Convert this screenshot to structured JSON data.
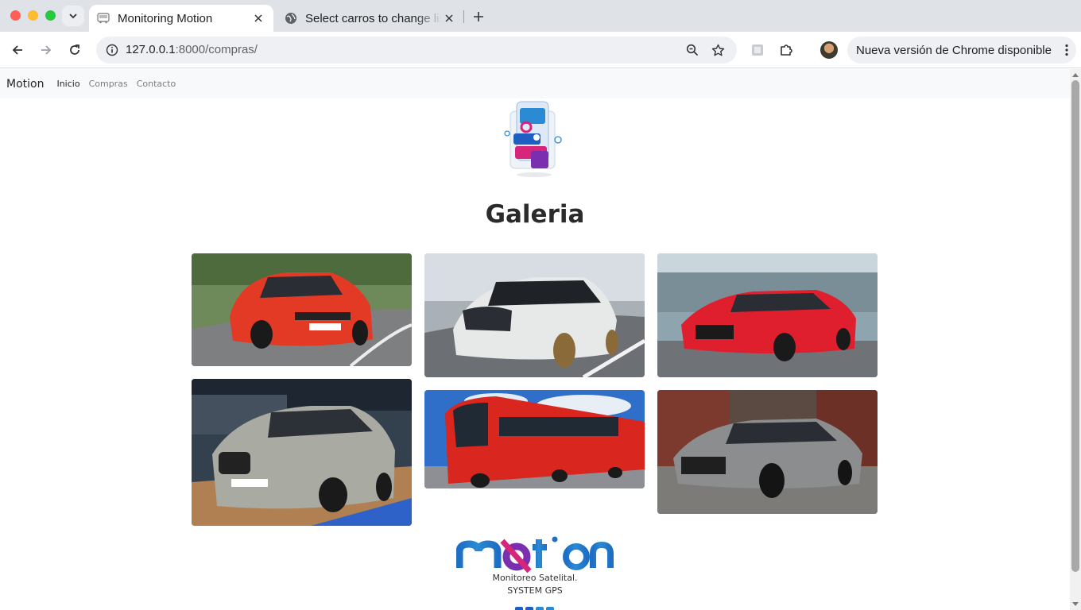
{
  "browser": {
    "tabs": [
      {
        "title": "Monitoring Motion",
        "active": true
      },
      {
        "title": "Select carros to change list | Django site admin",
        "active": false
      }
    ],
    "url_host": "127.0.0.1",
    "url_path": ":8000/compras/",
    "update_chip": "Nueva versión de Chrome disponible"
  },
  "navbar": {
    "brand": "Motion",
    "links": [
      "Inicio",
      "Compras",
      "Contacto"
    ]
  },
  "page": {
    "title": "Galeria"
  },
  "gallery": [
    {
      "name": "red-bmw-m2-photo",
      "bg": "#6f8a5a"
    },
    {
      "name": "white-bmw-m4-photo",
      "bg": "#a9b1b6"
    },
    {
      "name": "red-audi-rs7-photo",
      "bg": "#8ea4ae"
    },
    {
      "name": "silver-bmw-i5-photo",
      "bg": "#33404e"
    },
    {
      "name": "transmilenio-bus-photo",
      "bg": "#2f6fc9"
    },
    {
      "name": "grey-audi-rs7-photo",
      "bg": "#5a4a42"
    }
  ],
  "footer": {
    "tagline": "Monitoreo Satelital.",
    "subtitle": "SYSTEM GPS"
  },
  "colors": {
    "accent_blue": "#1e6fc4",
    "accent_pink": "#d6257a",
    "accent_purple": "#7b2fb0"
  }
}
